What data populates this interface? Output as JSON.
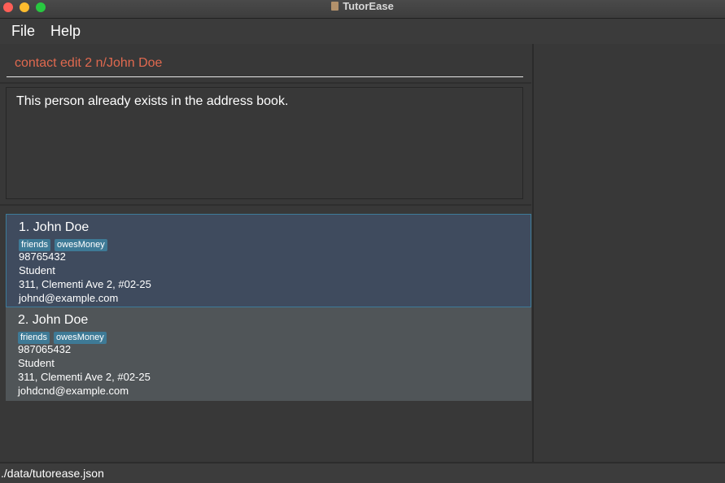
{
  "window": {
    "title": "TutorEase"
  },
  "menu": {
    "file": "File",
    "help": "Help"
  },
  "command": {
    "value": "contact edit 2 n/John Doe"
  },
  "result": {
    "message": "This person already exists in the address book."
  },
  "contacts": [
    {
      "name": "1. John Doe",
      "tags": [
        "friends",
        "owesMoney"
      ],
      "phone": "98765432",
      "role": "Student",
      "address": "311, Clementi Ave 2, #02-25",
      "email": "johnd@example.com"
    },
    {
      "name": "2. John  Doe",
      "tags": [
        "friends",
        "owesMoney"
      ],
      "phone": "987065432",
      "role": "Student",
      "address": "311, Clementi Ave 2, #02-25",
      "email": "johdcnd@example.com"
    }
  ],
  "status": {
    "path": "./data/tutorease.json"
  },
  "colors": {
    "background": "#383838",
    "command_text": "#e0694f",
    "selected_card": "#3f4b5e",
    "tag": "#3e7a96"
  }
}
